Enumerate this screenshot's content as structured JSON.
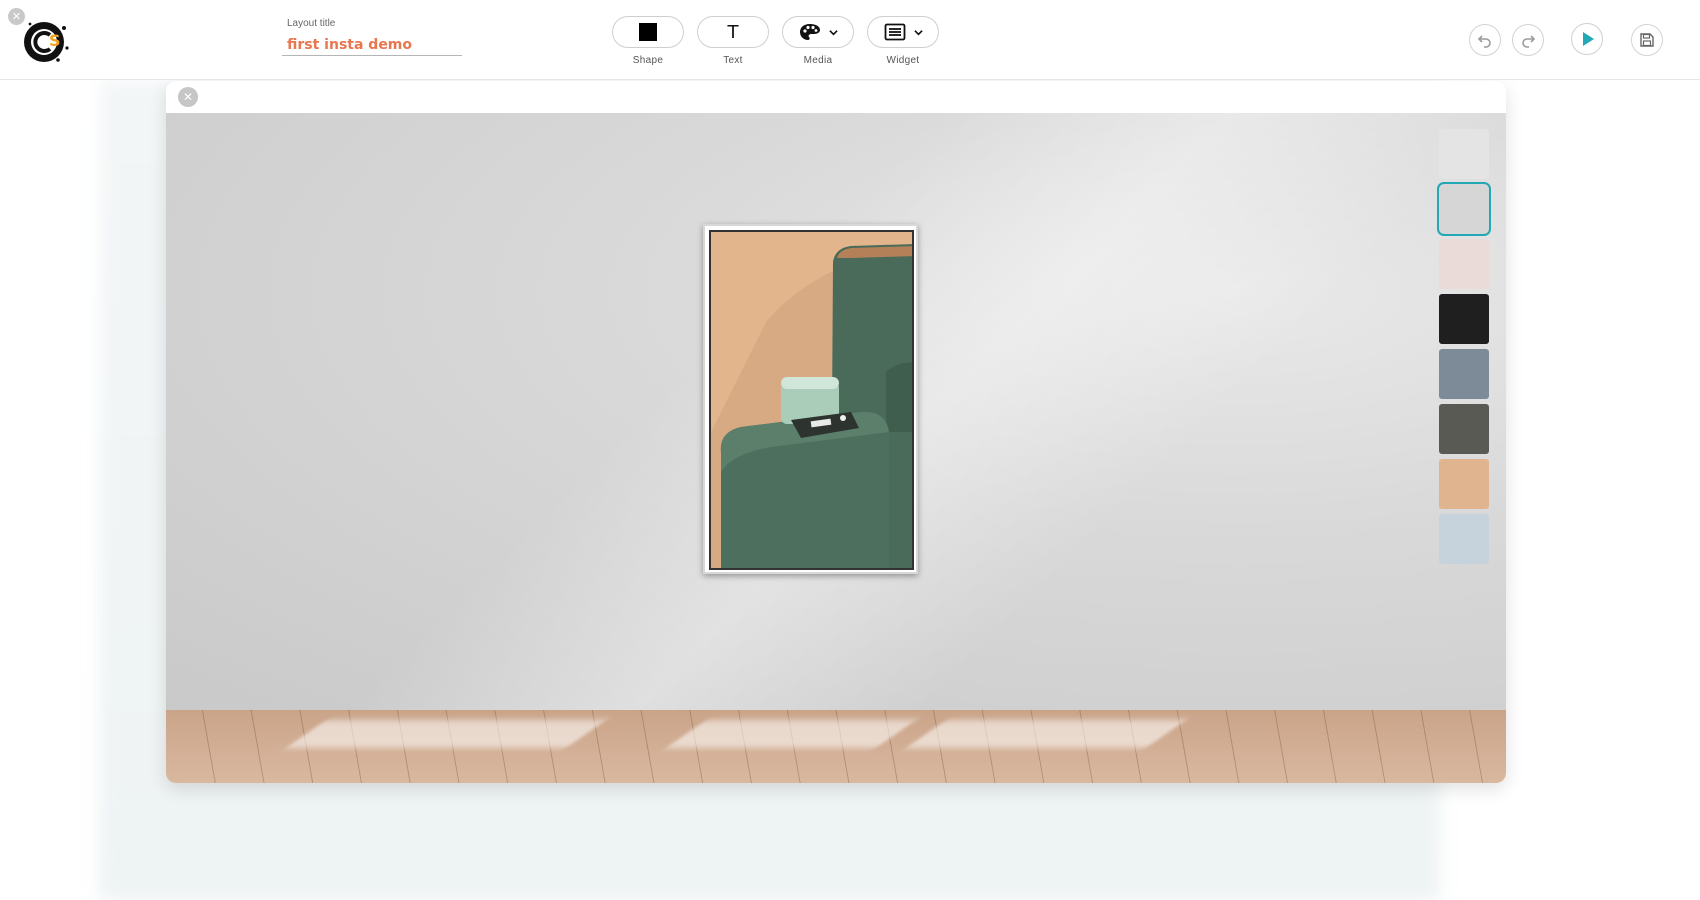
{
  "header": {
    "title_caption": "Layout title",
    "title_value": "first insta demo"
  },
  "tools": [
    {
      "label": "Shape",
      "icon": "square-icon"
    },
    {
      "label": "Text",
      "icon": "text-icon",
      "glyph": "T"
    },
    {
      "label": "Media",
      "icon": "palette-icon"
    },
    {
      "label": "Widget",
      "icon": "widget-icon"
    }
  ],
  "actions": {
    "undo_icon": "undo-icon",
    "redo_icon": "redo-icon",
    "play_icon": "play-icon",
    "save_icon": "save-icon"
  },
  "canvas": {
    "close_glyph": "✕",
    "selected_background_index": 1
  },
  "backgrounds": [
    {
      "name": "white-brick",
      "color": "#e4e4e4"
    },
    {
      "name": "light-gray-plaster",
      "color": "#d6d6d6"
    },
    {
      "name": "pink-room",
      "color": "#eadbd8"
    },
    {
      "name": "black-wall",
      "color": "#1f1f1f"
    },
    {
      "name": "blue-sofa",
      "color": "#7d8a98"
    },
    {
      "name": "kitchen-shelves",
      "color": "#5a5a55"
    },
    {
      "name": "marble-orange",
      "color": "#e0b48e"
    },
    {
      "name": "bed-blue-pillows",
      "color": "#c7d3dc"
    }
  ],
  "colors": {
    "accent": "#23a8b5",
    "title_text": "#e8774f"
  }
}
